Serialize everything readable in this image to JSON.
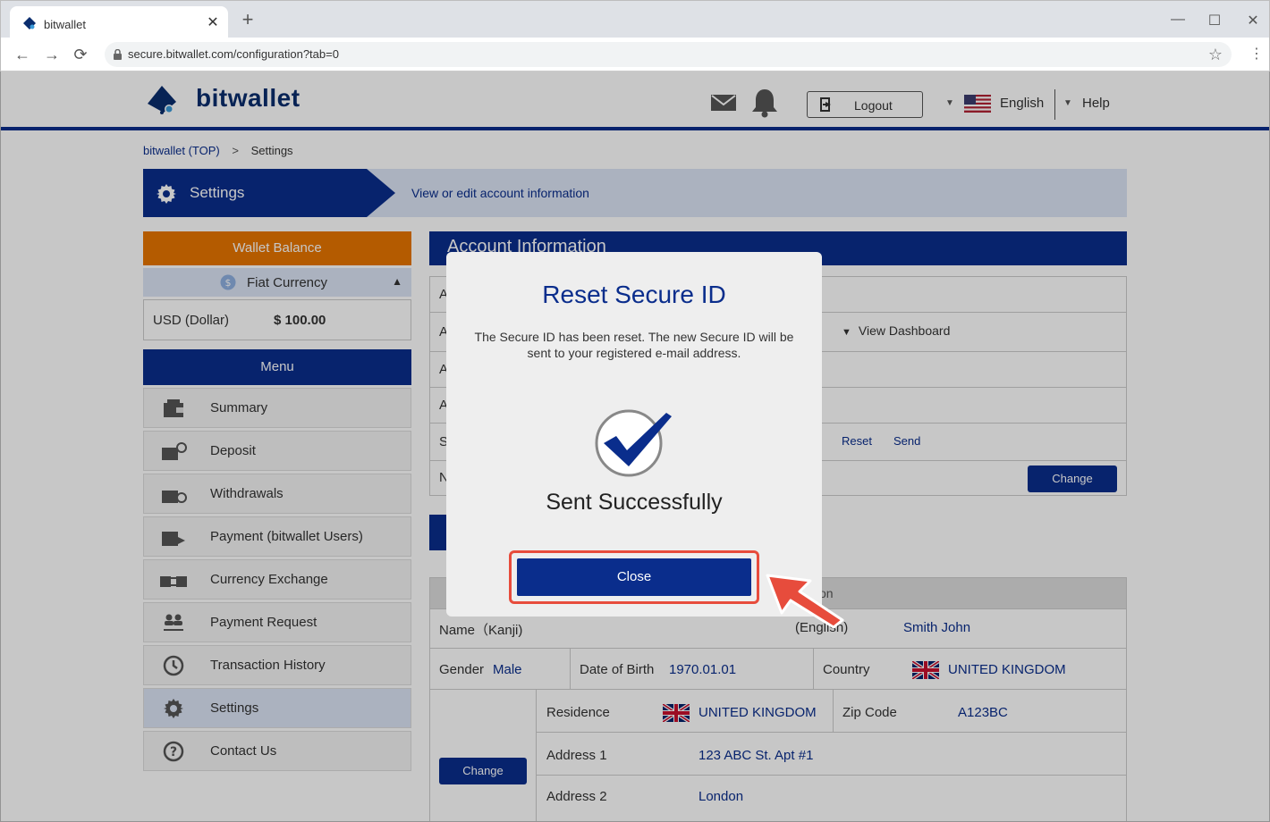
{
  "browser": {
    "tab_title": "bitwallet",
    "url": "secure.bitwallet.com/configuration?tab=0",
    "close_tab_glyph": "✕",
    "new_tab_glyph": "+",
    "minimize_glyph": "—",
    "maximize_glyph": "☐",
    "close_window_glyph": "✕",
    "back_glyph": "←",
    "forward_glyph": "→",
    "reload_glyph": "⟳",
    "star_glyph": "☆",
    "menu_glyph": "⋮"
  },
  "header": {
    "logo_text": "bitwallet",
    "logout_label": "Logout",
    "language": "English",
    "help": "Help",
    "caret_glyph": "▼"
  },
  "breadcrumb": {
    "home": "bitwallet (TOP)",
    "separator": ">",
    "current": "Settings"
  },
  "title_bar": {
    "title": "Settings",
    "description": "View or edit account information"
  },
  "sidebar": {
    "wallet_balance": "Wallet Balance",
    "fiat_currency": "Fiat Currency",
    "fiat_caret": "▲",
    "balance_currency": "USD (Dollar)",
    "balance_amount": "$ 100.00",
    "menu_title": "Menu",
    "items": [
      {
        "label": "Summary"
      },
      {
        "label": "Deposit"
      },
      {
        "label": "Withdrawals"
      },
      {
        "label": "Payment (bitwallet Users)"
      },
      {
        "label": "Currency Exchange"
      },
      {
        "label": "Payment Request"
      },
      {
        "label": "Transaction History"
      },
      {
        "label": "Settings"
      },
      {
        "label": "Contact Us"
      }
    ]
  },
  "account": {
    "title": "Account Information",
    "row_initials": [
      "A",
      "A",
      "A",
      "A",
      "S",
      "N"
    ],
    "view_dashboard": "View Dashboard",
    "view_caret": "▼",
    "reset": "Reset",
    "send": "Send",
    "change": "Change"
  },
  "personal": {
    "header_partial": "on",
    "name_kanji_label": "Name（Kanji)",
    "name_english_label": "(English)",
    "name_english_value": "Smith John",
    "gender_label": "Gender",
    "gender_value": "Male",
    "dob_label": "Date of Birth",
    "dob_value": "1970.01.01",
    "country_label": "Country",
    "country_value": "UNITED KINGDOM",
    "residence_label": "Residence",
    "residence_value": "UNITED KINGDOM",
    "zip_label": "Zip Code",
    "zip_value": "A123BC",
    "address1_label": "Address 1",
    "address1_value": "123 ABC St. Apt #1",
    "address2_label": "Address 2",
    "address2_value": "London",
    "change": "Change"
  },
  "modal": {
    "title": "Reset Secure ID",
    "message": "The Secure ID has been reset. The new Secure ID will be sent to your registered e-mail address.",
    "status": "Sent Successfully",
    "close_label": "Close"
  },
  "colors": {
    "brand_navy": "#0a2d8c",
    "orange": "#e77500",
    "highlight_red": "#e74c3c",
    "light_blue": "#dbe4f5"
  }
}
